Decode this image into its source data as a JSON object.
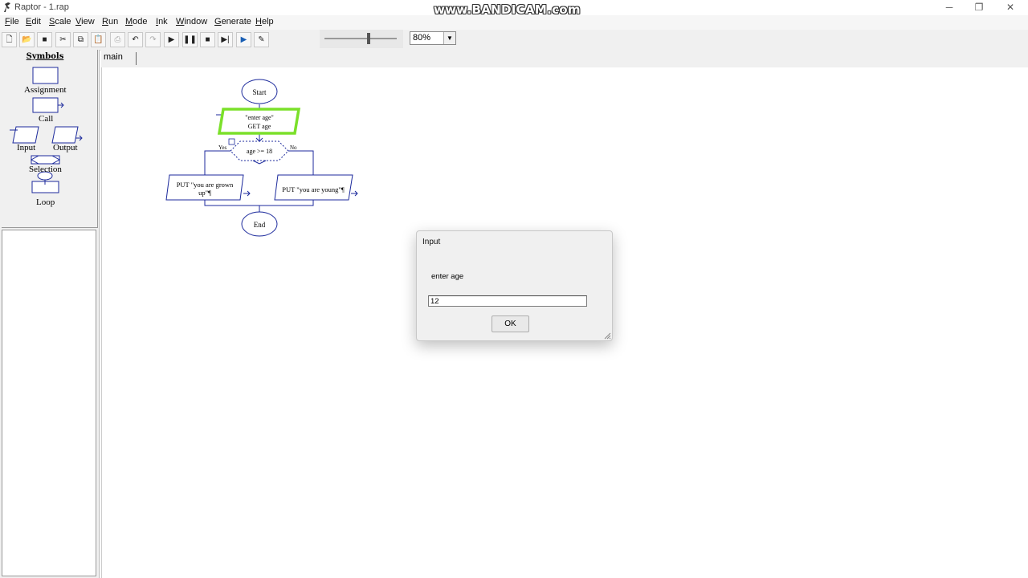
{
  "window": {
    "title": "Raptor - 1.rap",
    "watermark": "www.BANDICAM.com"
  },
  "menu": [
    {
      "label": "File",
      "key": "F",
      "rest": "ile"
    },
    {
      "label": "Edit",
      "key": "E",
      "rest": "dit"
    },
    {
      "label": "Scale",
      "key": "S",
      "rest": "cale"
    },
    {
      "label": "View",
      "key": "V",
      "rest": "iew"
    },
    {
      "label": "Run",
      "key": "R",
      "rest": "un"
    },
    {
      "label": "Mode",
      "key": "M",
      "rest": "ode"
    },
    {
      "label": "Ink",
      "key": "I",
      "rest": "nk"
    },
    {
      "label": "Window",
      "key": "W",
      "rest": "indow"
    },
    {
      "label": "Generate",
      "key": "G",
      "rest": "enerate"
    },
    {
      "label": "Help",
      "key": "H",
      "rest": "elp"
    }
  ],
  "toolbar": {
    "buttons": [
      "new-file",
      "open-folder",
      "save",
      "cut",
      "copy",
      "paste",
      "print",
      "undo",
      "redo",
      "run",
      "pause",
      "stop",
      "step",
      "step-to-completion",
      "ink-pen"
    ],
    "zoom": "80%",
    "speed_level": 0.6
  },
  "symbols": {
    "title": "Symbols",
    "assignment": "Assignment",
    "call": "Call",
    "input": "Input",
    "output": "Output",
    "selection": "Selection",
    "loop": "Loop"
  },
  "tabs": {
    "main": "main"
  },
  "flowchart": {
    "start": "Start",
    "input_prompt": "\"enter age\"",
    "input_var": "GET age",
    "condition": "age >= 18",
    "yes": "Yes",
    "no": "No",
    "yes_output_line1": "PUT \"you are grown",
    "yes_output_line2": "up\"¶",
    "no_output": "PUT \"you are young\"¶",
    "end": "End",
    "active_color": "#7be02a",
    "line_color": "#1c2a9c"
  },
  "dialog": {
    "title": "Input",
    "prompt": "enter age",
    "value": "12",
    "ok_label": "OK"
  }
}
